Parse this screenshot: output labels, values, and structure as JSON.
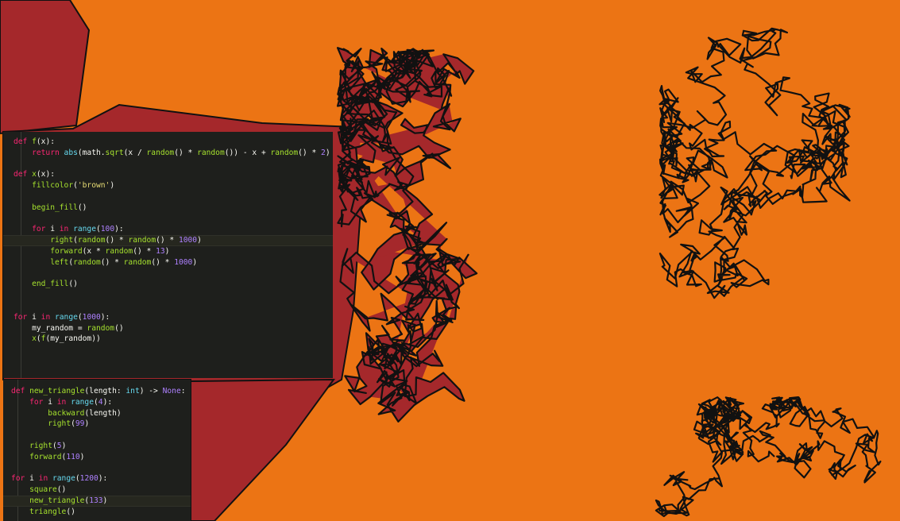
{
  "colors": {
    "background": "#ec7414",
    "fill": "#a5282b",
    "stroke": "#111111",
    "editor_bg": "#1e1f1c",
    "keyword": "#f92672",
    "function": "#a6e22e",
    "number": "#ae81ff",
    "string": "#e6db74",
    "builtin": "#66d9ef",
    "text": "#f8f8f2"
  },
  "canvas": {
    "drawing": "turtle-graphics random walk drawings",
    "walks": [
      "center-filled-walk",
      "right-top-walk",
      "right-bottom-walk"
    ]
  },
  "editor_top": {
    "lines": [
      {
        "segments": [
          {
            "t": "def ",
            "c": "kw"
          },
          {
            "t": "f",
            "c": "fn"
          },
          {
            "t": "(x):",
            "c": ""
          }
        ]
      },
      {
        "segments": [
          {
            "t": "    ",
            "c": ""
          },
          {
            "t": "return ",
            "c": "kw"
          },
          {
            "t": "abs",
            "c": "bi"
          },
          {
            "t": "(math.",
            "c": ""
          },
          {
            "t": "sqrt",
            "c": "fn"
          },
          {
            "t": "(x / ",
            "c": ""
          },
          {
            "t": "random",
            "c": "fn"
          },
          {
            "t": "() * ",
            "c": ""
          },
          {
            "t": "random",
            "c": "fn"
          },
          {
            "t": "()) - x + ",
            "c": ""
          },
          {
            "t": "random",
            "c": "fn"
          },
          {
            "t": "() * ",
            "c": ""
          },
          {
            "t": "2",
            "c": "num"
          },
          {
            "t": ")",
            "c": ""
          }
        ]
      },
      {
        "segments": []
      },
      {
        "segments": [
          {
            "t": "def ",
            "c": "kw"
          },
          {
            "t": "x",
            "c": "fn"
          },
          {
            "t": "(x):",
            "c": ""
          }
        ]
      },
      {
        "segments": [
          {
            "t": "    ",
            "c": ""
          },
          {
            "t": "fillcolor",
            "c": "fn"
          },
          {
            "t": "(",
            "c": ""
          },
          {
            "t": "'brown'",
            "c": "str"
          },
          {
            "t": ")",
            "c": ""
          }
        ]
      },
      {
        "segments": []
      },
      {
        "segments": [
          {
            "t": "    ",
            "c": ""
          },
          {
            "t": "begin_fill",
            "c": "fn"
          },
          {
            "t": "()",
            "c": ""
          }
        ]
      },
      {
        "segments": []
      },
      {
        "segments": [
          {
            "t": "    ",
            "c": ""
          },
          {
            "t": "for ",
            "c": "kw"
          },
          {
            "t": "i ",
            "c": ""
          },
          {
            "t": "in ",
            "c": "kw"
          },
          {
            "t": "range",
            "c": "bi"
          },
          {
            "t": "(",
            "c": ""
          },
          {
            "t": "100",
            "c": "num"
          },
          {
            "t": "):",
            "c": ""
          }
        ]
      },
      {
        "segments": [
          {
            "t": "        ",
            "c": ""
          },
          {
            "t": "right",
            "c": "fn"
          },
          {
            "t": "(",
            "c": ""
          },
          {
            "t": "random",
            "c": "fn"
          },
          {
            "t": "() * ",
            "c": ""
          },
          {
            "t": "random",
            "c": "fn"
          },
          {
            "t": "() * ",
            "c": ""
          },
          {
            "t": "1000",
            "c": "num"
          },
          {
            "t": ")",
            "c": ""
          }
        ],
        "hl": true
      },
      {
        "segments": [
          {
            "t": "        ",
            "c": ""
          },
          {
            "t": "forward",
            "c": "fn"
          },
          {
            "t": "(x * ",
            "c": ""
          },
          {
            "t": "random",
            "c": "fn"
          },
          {
            "t": "() * ",
            "c": ""
          },
          {
            "t": "13",
            "c": "num"
          },
          {
            "t": ")",
            "c": ""
          }
        ]
      },
      {
        "segments": [
          {
            "t": "        ",
            "c": ""
          },
          {
            "t": "left",
            "c": "fn"
          },
          {
            "t": "(",
            "c": ""
          },
          {
            "t": "random",
            "c": "fn"
          },
          {
            "t": "() * ",
            "c": ""
          },
          {
            "t": "random",
            "c": "fn"
          },
          {
            "t": "() * ",
            "c": ""
          },
          {
            "t": "1000",
            "c": "num"
          },
          {
            "t": ")",
            "c": ""
          }
        ]
      },
      {
        "segments": []
      },
      {
        "segments": [
          {
            "t": "    ",
            "c": ""
          },
          {
            "t": "end_fill",
            "c": "fn"
          },
          {
            "t": "()",
            "c": ""
          }
        ]
      },
      {
        "segments": []
      },
      {
        "segments": []
      },
      {
        "segments": [
          {
            "t": "for ",
            "c": "kw"
          },
          {
            "t": "i ",
            "c": ""
          },
          {
            "t": "in ",
            "c": "kw"
          },
          {
            "t": "range",
            "c": "bi"
          },
          {
            "t": "(",
            "c": ""
          },
          {
            "t": "1000",
            "c": "num"
          },
          {
            "t": "):",
            "c": ""
          }
        ]
      },
      {
        "segments": [
          {
            "t": "    my_random = ",
            "c": ""
          },
          {
            "t": "random",
            "c": "fn"
          },
          {
            "t": "()",
            "c": ""
          }
        ]
      },
      {
        "segments": [
          {
            "t": "    ",
            "c": ""
          },
          {
            "t": "x",
            "c": "fn"
          },
          {
            "t": "(",
            "c": ""
          },
          {
            "t": "f",
            "c": "fn"
          },
          {
            "t": "(my_random))",
            "c": ""
          }
        ]
      }
    ]
  },
  "editor_bottom": {
    "lines": [
      {
        "segments": [
          {
            "t": "def ",
            "c": "kw"
          },
          {
            "t": "new_triangle",
            "c": "fn"
          },
          {
            "t": "(length: ",
            "c": ""
          },
          {
            "t": "int",
            "c": "bi"
          },
          {
            "t": ") -> ",
            "c": ""
          },
          {
            "t": "None",
            "c": "num"
          },
          {
            "t": ":",
            "c": ""
          }
        ]
      },
      {
        "segments": [
          {
            "t": "    ",
            "c": ""
          },
          {
            "t": "for ",
            "c": "kw"
          },
          {
            "t": "i ",
            "c": ""
          },
          {
            "t": "in ",
            "c": "kw"
          },
          {
            "t": "range",
            "c": "bi"
          },
          {
            "t": "(",
            "c": ""
          },
          {
            "t": "4",
            "c": "num"
          },
          {
            "t": "):",
            "c": ""
          }
        ]
      },
      {
        "segments": [
          {
            "t": "        ",
            "c": ""
          },
          {
            "t": "backward",
            "c": "fn"
          },
          {
            "t": "(length)",
            "c": ""
          }
        ]
      },
      {
        "segments": [
          {
            "t": "        ",
            "c": ""
          },
          {
            "t": "right",
            "c": "fn"
          },
          {
            "t": "(",
            "c": ""
          },
          {
            "t": "99",
            "c": "num"
          },
          {
            "t": ")",
            "c": ""
          }
        ]
      },
      {
        "segments": []
      },
      {
        "segments": [
          {
            "t": "    ",
            "c": ""
          },
          {
            "t": "right",
            "c": "fn"
          },
          {
            "t": "(",
            "c": ""
          },
          {
            "t": "5",
            "c": "num"
          },
          {
            "t": ")",
            "c": ""
          }
        ]
      },
      {
        "segments": [
          {
            "t": "    ",
            "c": ""
          },
          {
            "t": "forward",
            "c": "fn"
          },
          {
            "t": "(",
            "c": ""
          },
          {
            "t": "110",
            "c": "num"
          },
          {
            "t": ")",
            "c": ""
          }
        ]
      },
      {
        "segments": []
      },
      {
        "segments": [
          {
            "t": "for ",
            "c": "kw"
          },
          {
            "t": "i ",
            "c": ""
          },
          {
            "t": "in ",
            "c": "kw"
          },
          {
            "t": "range",
            "c": "bi"
          },
          {
            "t": "(",
            "c": ""
          },
          {
            "t": "1200",
            "c": "num"
          },
          {
            "t": "):",
            "c": ""
          }
        ]
      },
      {
        "segments": [
          {
            "t": "    ",
            "c": ""
          },
          {
            "t": "square",
            "c": "fn"
          },
          {
            "t": "()",
            "c": ""
          }
        ]
      },
      {
        "segments": [
          {
            "t": "    ",
            "c": ""
          },
          {
            "t": "new_triangle",
            "c": "fn"
          },
          {
            "t": "(",
            "c": ""
          },
          {
            "t": "133",
            "c": "num"
          },
          {
            "t": ")",
            "c": ""
          }
        ],
        "hl": true
      },
      {
        "segments": [
          {
            "t": "    ",
            "c": ""
          },
          {
            "t": "triangle",
            "c": "fn"
          },
          {
            "t": "()",
            "c": ""
          }
        ]
      }
    ]
  }
}
